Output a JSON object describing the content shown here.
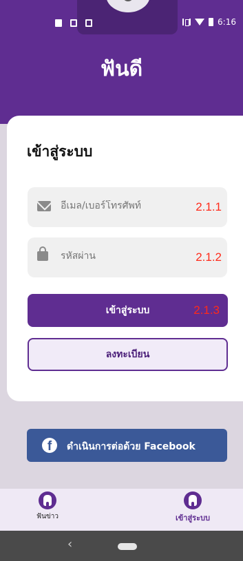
{
  "status_bar": {
    "time": "6:16",
    "left_icons": [
      "image-icon",
      "screenshot-icon",
      "sim-icon"
    ],
    "right_icons": [
      "vibrate-icon",
      "wifi-icon",
      "battery-icon"
    ]
  },
  "app": {
    "title": "ฟันดี"
  },
  "login": {
    "title": "เข้าสู่ระบบ",
    "email_placeholder": "อีเมล/เบอร์โทรศัพท์",
    "email_value": "",
    "password_placeholder": "รหัสผ่าน",
    "password_value": "",
    "login_button": "เข้าสู่ระบบ",
    "register_button": "ลงทะเบียน"
  },
  "annotations": {
    "email": "2.1.1",
    "password": "2.1.2",
    "login": "2.1.3"
  },
  "facebook": {
    "label": "ดำเนินการต่อด้วย Facebook",
    "icon_letter": "f"
  },
  "bottom_nav": {
    "items": [
      {
        "label": "ฟันข่าว",
        "icon": "tooth-icon",
        "active": false
      },
      {
        "label": "เข้าสู่ระบบ",
        "icon": "tooth-icon",
        "active": true
      }
    ]
  },
  "colors": {
    "brand": "#5f2d91",
    "facebook": "#3b5998",
    "annotation": "#ff2a1a"
  }
}
